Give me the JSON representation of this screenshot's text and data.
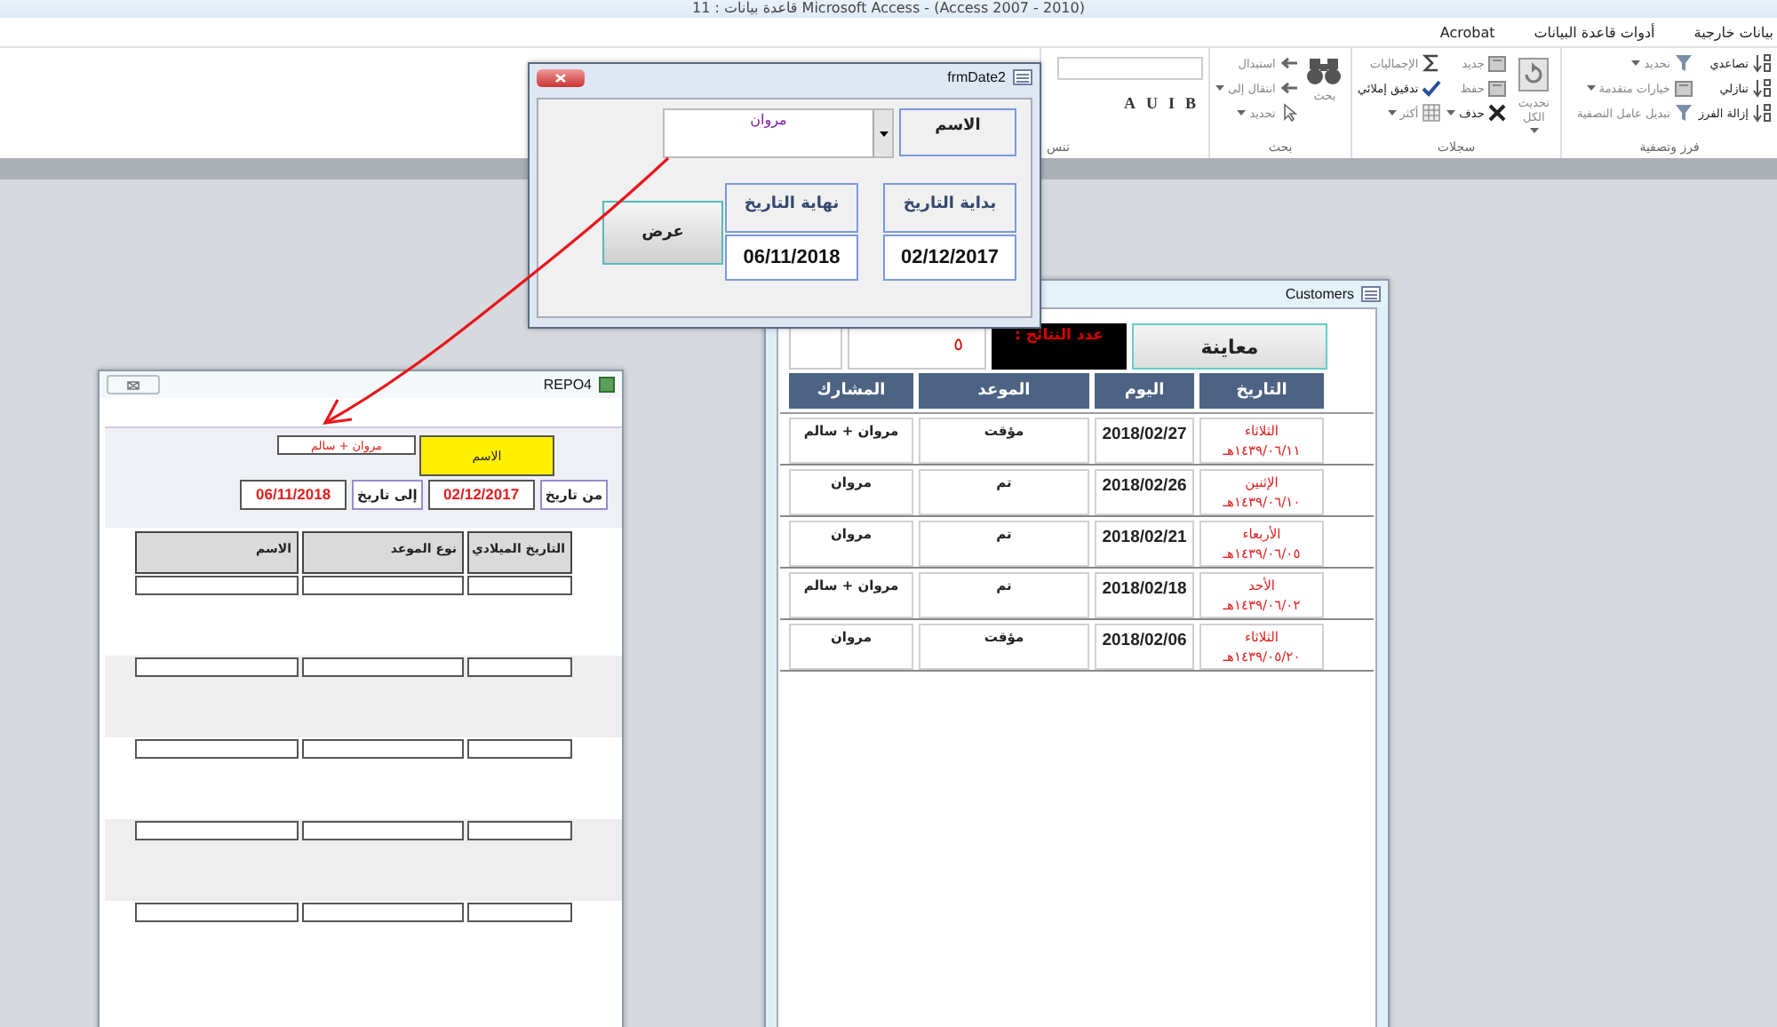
{
  "app_title": "Microsoft Access - (Access 2007 - 2010) قاعدة بيانات : 11",
  "ribbon": {
    "tabs": [
      {
        "label": "بيانات خارجية"
      },
      {
        "label": "أدوات قاعدة البيانات"
      },
      {
        "label": "Acrobat"
      }
    ],
    "groups": [
      {
        "label": "فرز وتصفية",
        "columns": [
          [
            {
              "label": "تصاعدي",
              "kind": "sort",
              "dropdown": false,
              "disabled": false
            },
            {
              "label": "تنازلي",
              "kind": "sort",
              "dropdown": false,
              "disabled": false
            },
            {
              "label": "إزالة الفرز",
              "kind": "sort",
              "dropdown": false,
              "disabled": false
            }
          ],
          [
            {
              "label": "تحديد",
              "kind": "filter",
              "dropdown": true,
              "disabled": true
            },
            {
              "label": "خيارات متقدمة",
              "kind": "doc",
              "dropdown": true,
              "disabled": true
            },
            {
              "label": "تبديل عامل التصفية",
              "kind": "filter",
              "dropdown": false,
              "disabled": true
            }
          ]
        ]
      },
      {
        "label": "سجلات",
        "large": {
          "label": "تحديث الكل",
          "kind": "refresh",
          "dropdown": true,
          "disabled": true
        },
        "columns": [
          [
            {
              "label": "جديد",
              "kind": "doc",
              "dropdown": false,
              "disabled": true
            },
            {
              "label": "حفظ",
              "kind": "doc",
              "dropdown": false,
              "disabled": true
            },
            {
              "label": "حذف",
              "kind": "delete",
              "dropdown": true,
              "disabled": false
            }
          ],
          [
            {
              "label": "الإجماليات",
              "kind": "sum",
              "dropdown": false,
              "disabled": true
            },
            {
              "label": "تدقيق إملائي",
              "kind": "check",
              "dropdown": false,
              "disabled": false
            },
            {
              "label": "أكثر",
              "kind": "grid",
              "dropdown": true,
              "disabled": true
            }
          ]
        ]
      },
      {
        "label": "بحث",
        "large": {
          "label": "بحث",
          "kind": "binoculars",
          "dropdown": false,
          "disabled": true
        },
        "columns": [
          [
            {
              "label": "استبدال",
              "kind": "arrow",
              "dropdown": false,
              "disabled": true
            },
            {
              "label": "انتقال إلى",
              "kind": "arrow",
              "dropdown": true,
              "disabled": true
            },
            {
              "label": "تحديد",
              "kind": "cursor",
              "dropdown": true,
              "disabled": true
            }
          ]
        ]
      },
      {
        "label": "تنس",
        "format_buttons": [
          "B",
          "I",
          "U",
          "A"
        ]
      }
    ]
  },
  "frmDate2": {
    "title": "frmDate2",
    "name_label": "الاسم",
    "name_value": "مروان",
    "start_label": "بداية التاريخ",
    "start_value": "02/12/2017",
    "end_label": "نهاية التاريخ",
    "end_value": "06/11/2018",
    "button": "عرض"
  },
  "customers": {
    "title": "Customers",
    "preview_button": "معاينة",
    "count_label": "عدد النتائج :",
    "count_value": "٥",
    "columns": [
      "التاريخ",
      "اليوم",
      "الموعد",
      "المشارك"
    ],
    "rows": [
      {
        "weekday": "الثلاثاء",
        "hijri": "١٤٣٩/٠٦/١١هـ",
        "date": "2018/02/27",
        "status": "مؤقت",
        "participant": "مروان + سالم"
      },
      {
        "weekday": "الإثنين",
        "hijri": "١٤٣٩/٠٦/١٠هـ",
        "date": "2018/02/26",
        "status": "تم",
        "participant": "مروان"
      },
      {
        "weekday": "الأربعاء",
        "hijri": "١٤٣٩/٠٦/٠٥هـ",
        "date": "2018/02/21",
        "status": "تم",
        "participant": "مروان"
      },
      {
        "weekday": "الأحد",
        "hijri": "١٤٣٩/٠٦/٠٢هـ",
        "date": "2018/02/18",
        "status": "تم",
        "participant": "مروان + سالم"
      },
      {
        "weekday": "الثلاثاء",
        "hijri": "١٤٣٩/٠٥/٢٠هـ",
        "date": "2018/02/06",
        "status": "مؤقت",
        "participant": "مروان"
      }
    ]
  },
  "repo4": {
    "title": "REPO4",
    "name_label": "الاسم",
    "name_value": "مروان + سالم",
    "from_label": "من تاريخ",
    "from_value": "02/12/2017",
    "to_label": "إلى تاريخ",
    "to_value": "06/11/2018",
    "columns": [
      "التاريخ الميلادي",
      "نوع الموعد",
      "الاسم"
    ]
  }
}
